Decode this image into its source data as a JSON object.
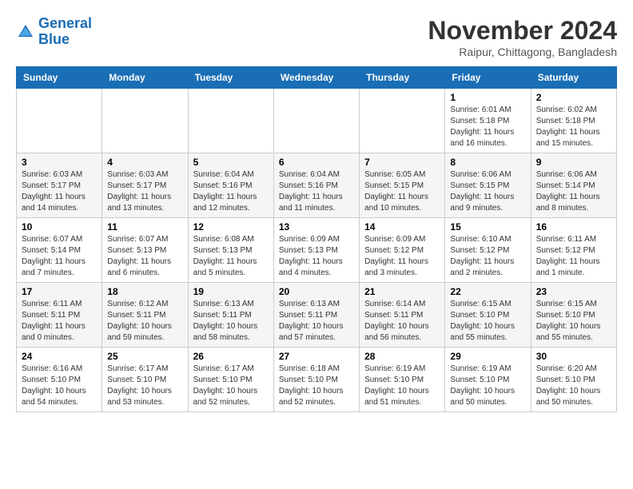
{
  "header": {
    "logo_line1": "General",
    "logo_line2": "Blue",
    "month": "November 2024",
    "location": "Raipur, Chittagong, Bangladesh"
  },
  "weekdays": [
    "Sunday",
    "Monday",
    "Tuesday",
    "Wednesday",
    "Thursday",
    "Friday",
    "Saturday"
  ],
  "weeks": [
    [
      {
        "day": "",
        "info": ""
      },
      {
        "day": "",
        "info": ""
      },
      {
        "day": "",
        "info": ""
      },
      {
        "day": "",
        "info": ""
      },
      {
        "day": "",
        "info": ""
      },
      {
        "day": "1",
        "info": "Sunrise: 6:01 AM\nSunset: 5:18 PM\nDaylight: 11 hours and 16 minutes."
      },
      {
        "day": "2",
        "info": "Sunrise: 6:02 AM\nSunset: 5:18 PM\nDaylight: 11 hours and 15 minutes."
      }
    ],
    [
      {
        "day": "3",
        "info": "Sunrise: 6:03 AM\nSunset: 5:17 PM\nDaylight: 11 hours and 14 minutes."
      },
      {
        "day": "4",
        "info": "Sunrise: 6:03 AM\nSunset: 5:17 PM\nDaylight: 11 hours and 13 minutes."
      },
      {
        "day": "5",
        "info": "Sunrise: 6:04 AM\nSunset: 5:16 PM\nDaylight: 11 hours and 12 minutes."
      },
      {
        "day": "6",
        "info": "Sunrise: 6:04 AM\nSunset: 5:16 PM\nDaylight: 11 hours and 11 minutes."
      },
      {
        "day": "7",
        "info": "Sunrise: 6:05 AM\nSunset: 5:15 PM\nDaylight: 11 hours and 10 minutes."
      },
      {
        "day": "8",
        "info": "Sunrise: 6:06 AM\nSunset: 5:15 PM\nDaylight: 11 hours and 9 minutes."
      },
      {
        "day": "9",
        "info": "Sunrise: 6:06 AM\nSunset: 5:14 PM\nDaylight: 11 hours and 8 minutes."
      }
    ],
    [
      {
        "day": "10",
        "info": "Sunrise: 6:07 AM\nSunset: 5:14 PM\nDaylight: 11 hours and 7 minutes."
      },
      {
        "day": "11",
        "info": "Sunrise: 6:07 AM\nSunset: 5:13 PM\nDaylight: 11 hours and 6 minutes."
      },
      {
        "day": "12",
        "info": "Sunrise: 6:08 AM\nSunset: 5:13 PM\nDaylight: 11 hours and 5 minutes."
      },
      {
        "day": "13",
        "info": "Sunrise: 6:09 AM\nSunset: 5:13 PM\nDaylight: 11 hours and 4 minutes."
      },
      {
        "day": "14",
        "info": "Sunrise: 6:09 AM\nSunset: 5:12 PM\nDaylight: 11 hours and 3 minutes."
      },
      {
        "day": "15",
        "info": "Sunrise: 6:10 AM\nSunset: 5:12 PM\nDaylight: 11 hours and 2 minutes."
      },
      {
        "day": "16",
        "info": "Sunrise: 6:11 AM\nSunset: 5:12 PM\nDaylight: 11 hours and 1 minute."
      }
    ],
    [
      {
        "day": "17",
        "info": "Sunrise: 6:11 AM\nSunset: 5:11 PM\nDaylight: 11 hours and 0 minutes."
      },
      {
        "day": "18",
        "info": "Sunrise: 6:12 AM\nSunset: 5:11 PM\nDaylight: 10 hours and 59 minutes."
      },
      {
        "day": "19",
        "info": "Sunrise: 6:13 AM\nSunset: 5:11 PM\nDaylight: 10 hours and 58 minutes."
      },
      {
        "day": "20",
        "info": "Sunrise: 6:13 AM\nSunset: 5:11 PM\nDaylight: 10 hours and 57 minutes."
      },
      {
        "day": "21",
        "info": "Sunrise: 6:14 AM\nSunset: 5:11 PM\nDaylight: 10 hours and 56 minutes."
      },
      {
        "day": "22",
        "info": "Sunrise: 6:15 AM\nSunset: 5:10 PM\nDaylight: 10 hours and 55 minutes."
      },
      {
        "day": "23",
        "info": "Sunrise: 6:15 AM\nSunset: 5:10 PM\nDaylight: 10 hours and 55 minutes."
      }
    ],
    [
      {
        "day": "24",
        "info": "Sunrise: 6:16 AM\nSunset: 5:10 PM\nDaylight: 10 hours and 54 minutes."
      },
      {
        "day": "25",
        "info": "Sunrise: 6:17 AM\nSunset: 5:10 PM\nDaylight: 10 hours and 53 minutes."
      },
      {
        "day": "26",
        "info": "Sunrise: 6:17 AM\nSunset: 5:10 PM\nDaylight: 10 hours and 52 minutes."
      },
      {
        "day": "27",
        "info": "Sunrise: 6:18 AM\nSunset: 5:10 PM\nDaylight: 10 hours and 52 minutes."
      },
      {
        "day": "28",
        "info": "Sunrise: 6:19 AM\nSunset: 5:10 PM\nDaylight: 10 hours and 51 minutes."
      },
      {
        "day": "29",
        "info": "Sunrise: 6:19 AM\nSunset: 5:10 PM\nDaylight: 10 hours and 50 minutes."
      },
      {
        "day": "30",
        "info": "Sunrise: 6:20 AM\nSunset: 5:10 PM\nDaylight: 10 hours and 50 minutes."
      }
    ]
  ]
}
